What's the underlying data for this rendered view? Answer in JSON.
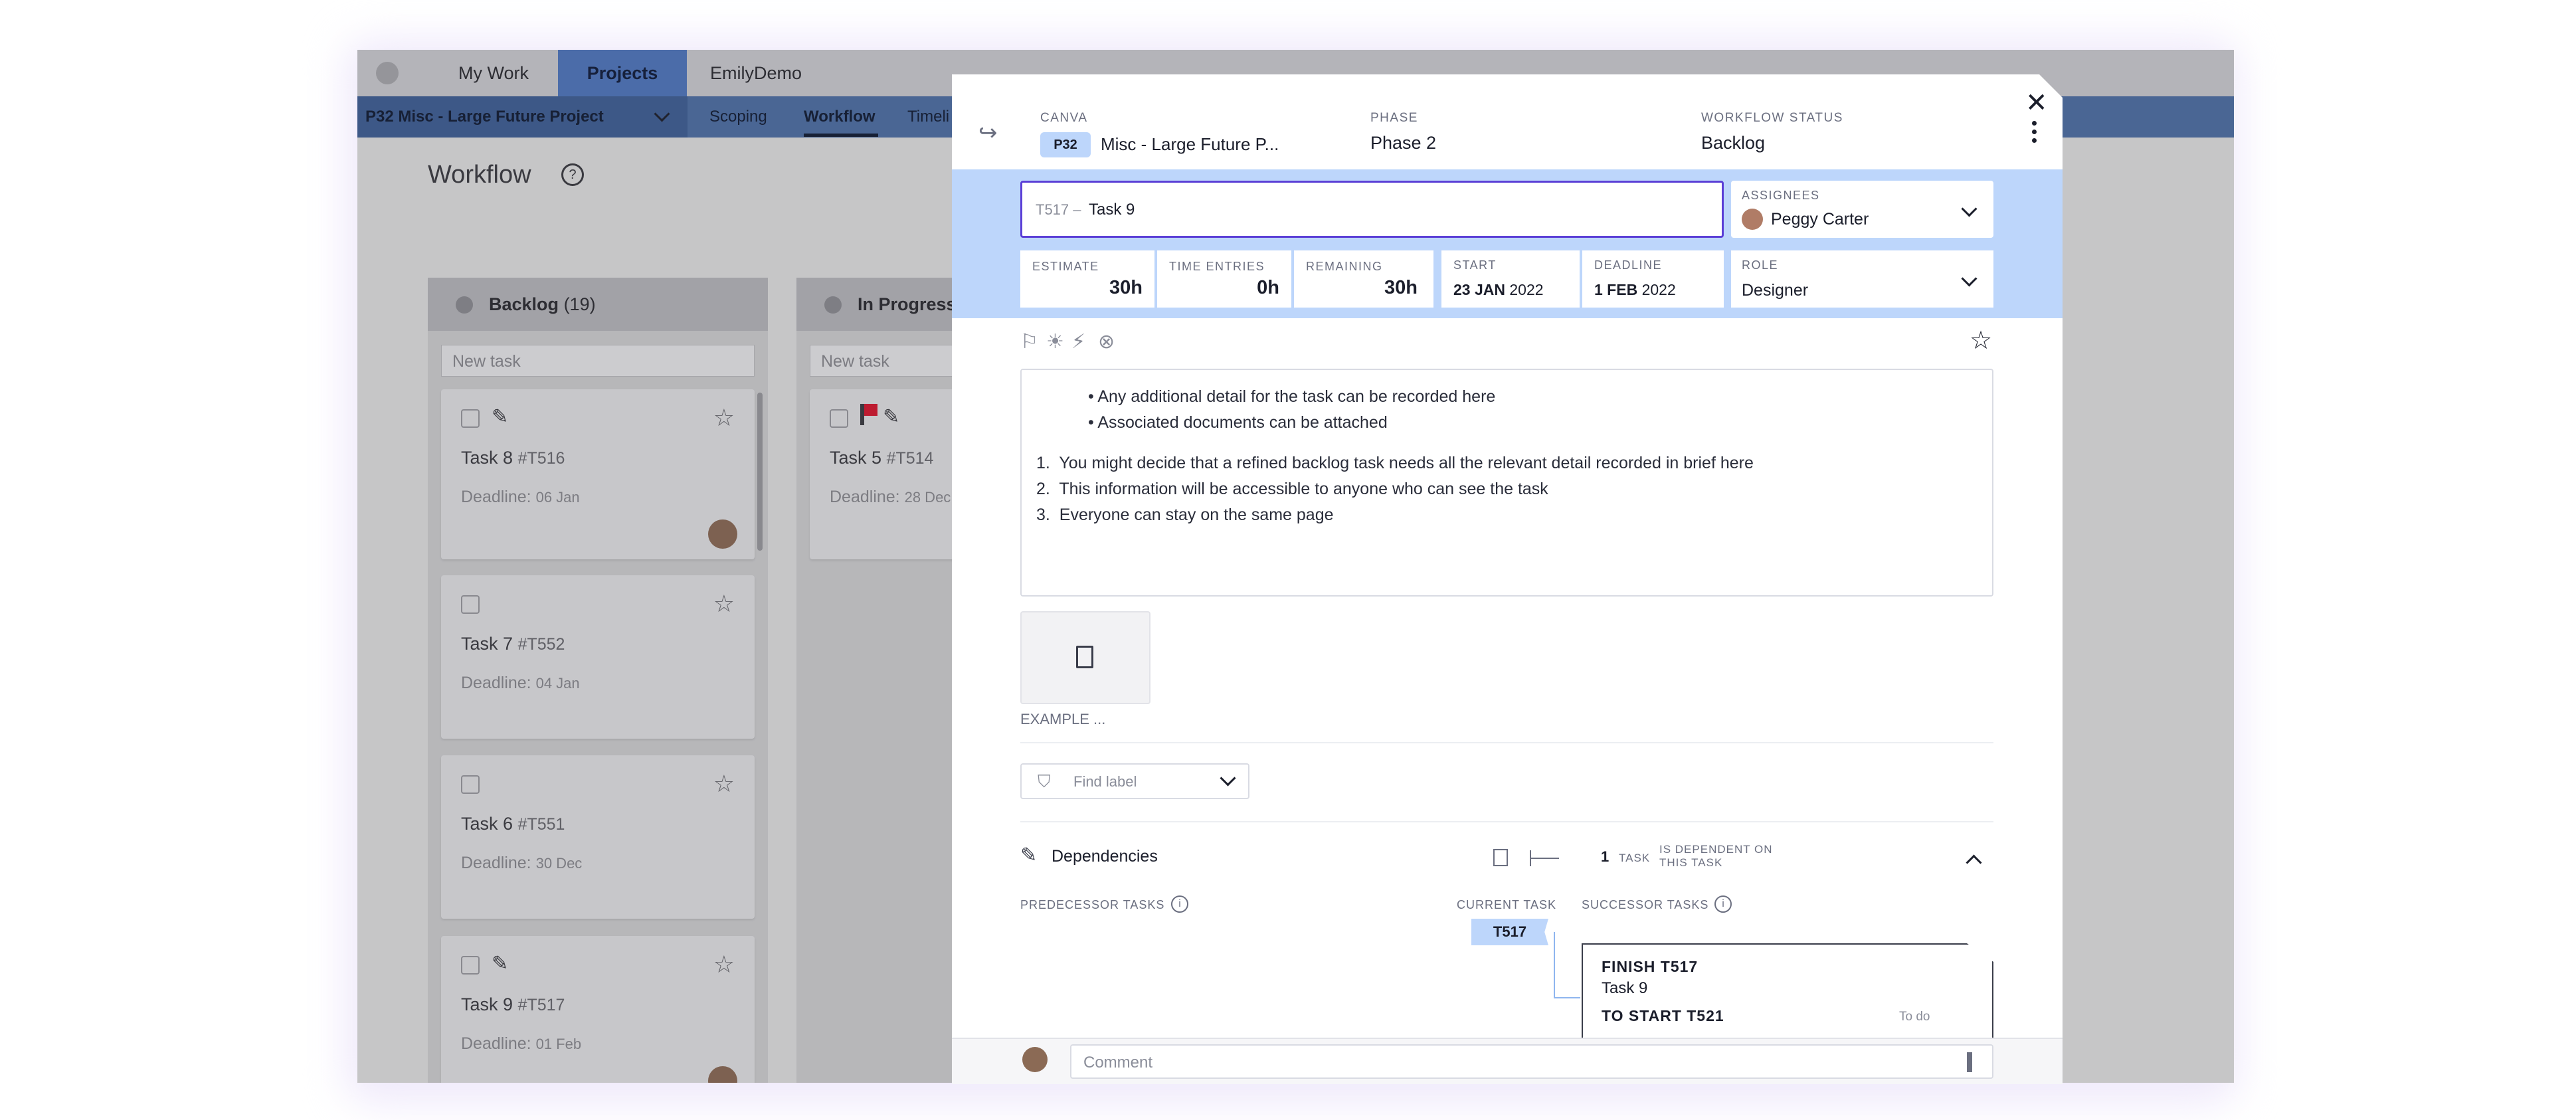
{
  "app": {
    "nav": {
      "my_work": "My Work",
      "projects": "Projects",
      "emily_demo": "EmilyDemo"
    },
    "project_selector": "P32 Misc - Large Future Project",
    "subnav": {
      "scoping": "Scoping",
      "workflow": "Workflow",
      "timeline": "Timeli"
    },
    "page_title": "Workflow",
    "columns": {
      "backlog": {
        "title": "Backlog",
        "count": "(19)"
      },
      "in_progress": {
        "title": "In Progress"
      }
    },
    "new_task_placeholder": "New task",
    "cards": [
      {
        "name": "Task 8",
        "id": "#T516",
        "deadline_label": "Deadline:",
        "deadline": "06 Jan"
      },
      {
        "name": "Task 7",
        "id": "#T552",
        "deadline_label": "Deadline:",
        "deadline": "04 Jan"
      },
      {
        "name": "Task 6",
        "id": "#T551",
        "deadline_label": "Deadline:",
        "deadline": "30 Dec"
      },
      {
        "name": "Task 9",
        "id": "#T517",
        "deadline_label": "Deadline:",
        "deadline": "01 Feb"
      }
    ],
    "in_progress_card": {
      "name": "Task 5",
      "id": "#T514",
      "deadline_label": "Deadline:",
      "deadline": "28 Dec"
    }
  },
  "modal": {
    "canva_label": "CANVA",
    "project_badge": "P32",
    "project_name": "Misc - Large Future P...",
    "phase_label": "PHASE",
    "phase_value": "Phase 2",
    "status_label": "WORKFLOW STATUS",
    "status_value": "Backlog",
    "task_prefix": "T517 –",
    "task_name": "Task 9",
    "assignees_label": "ASSIGNEES",
    "assignee": "Peggy Carter",
    "estimate_label": "ESTIMATE",
    "estimate": "30h",
    "time_entries_label": "TIME ENTRIES",
    "time_entries": "0h",
    "remaining_label": "REMAINING",
    "remaining": "30h",
    "start_label": "START",
    "start_day": "23 JAN",
    "start_year": "2022",
    "deadline_label": "DEADLINE",
    "deadline_day": "1 FEB",
    "deadline_year": "2022",
    "role_label": "ROLE",
    "role": "Designer",
    "description": {
      "bullets": [
        "Any additional detail for the task can be recorded here",
        "Associated documents can be attached"
      ],
      "numbered": [
        "You might decide that a refined backlog task needs all the relevant detail recorded in brief here",
        "This information will be accessible to anyone who can see the task",
        "Everyone can stay on the same page"
      ],
      "numbers": [
        "1.",
        "2.",
        "3."
      ]
    },
    "attachment_name": "EXAMPLE ...",
    "label_placeholder": "Find label",
    "dependencies": {
      "title": "Dependencies",
      "count": "1",
      "count_unit": "TASK",
      "count_text_1": "IS DEPENDENT ON",
      "count_text_2": "THIS TASK",
      "predecessor_label": "PREDECESSOR TASKS",
      "current_label": "CURRENT TASK",
      "successor_label": "SUCCESSOR TASKS",
      "current_id": "T517",
      "finish_line": "FINISH T517",
      "finish_task": "Task 9",
      "start_line": "TO START T521",
      "start_status": "To do"
    },
    "comment_placeholder": "Comment"
  },
  "colors": {
    "accent": "#4f77c0",
    "band": "#bdd6fb",
    "focus_border": "#5b3fd6",
    "flag_red": "#d9142c",
    "badge": "#bdd6fb"
  }
}
